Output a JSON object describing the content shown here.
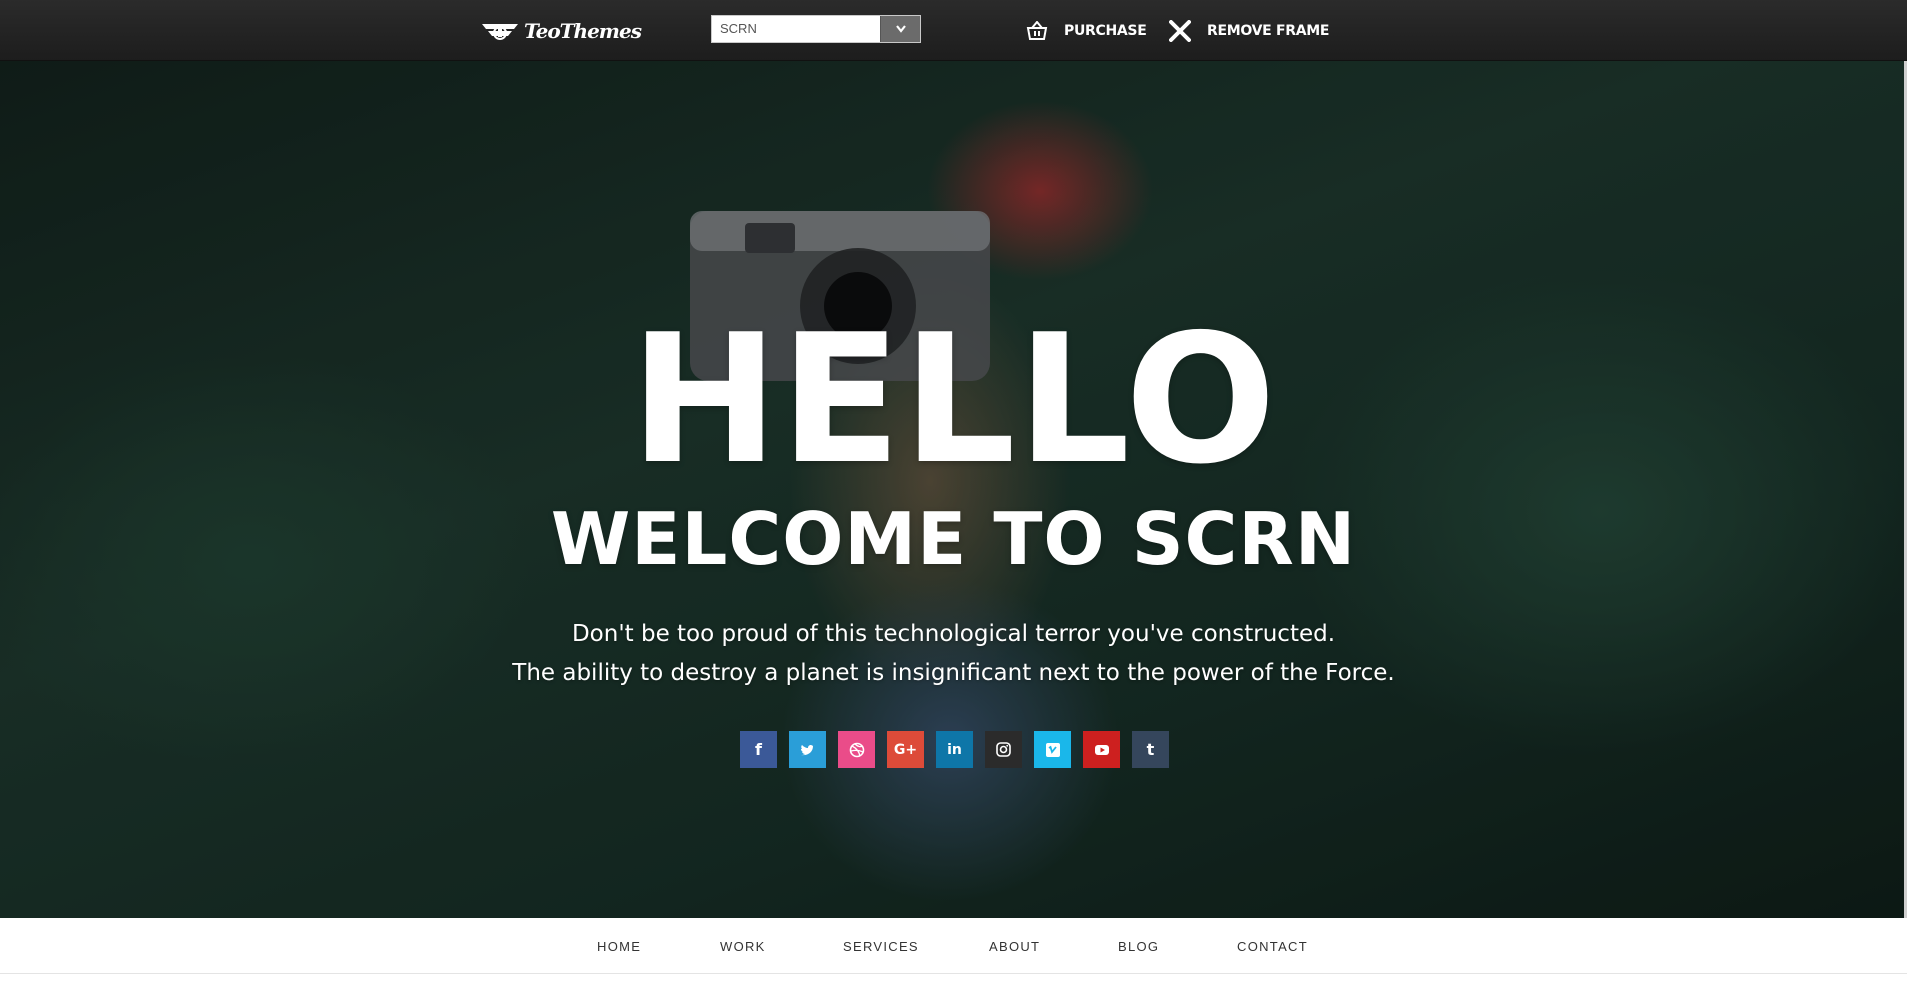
{
  "topbar": {
    "logo_text": "TeoThemes",
    "theme_select": {
      "value": "SCRN"
    },
    "purchase_label": "PURCHASE",
    "remove_frame_label": "REMOVE FRAME"
  },
  "hero": {
    "headline": "HELLO",
    "subheadline": "WELCOME TO SCRN",
    "tagline_line1": "Don't be too proud of this technological terror you've constructed.",
    "tagline_line2": "The ability to destroy a planet is insignificant next to the power of the Force.",
    "socials": [
      {
        "icon": "facebook-icon",
        "glyph": "f",
        "color": "#3b5998"
      },
      {
        "icon": "twitter-icon",
        "glyph": "t",
        "color": "#2a9ed8"
      },
      {
        "icon": "dribbble-icon",
        "glyph": "◎",
        "color": "#ea4c89"
      },
      {
        "icon": "google-plus-icon",
        "glyph": "G+",
        "color": "#dd4b39"
      },
      {
        "icon": "linkedin-icon",
        "glyph": "in",
        "color": "#0e76a8"
      },
      {
        "icon": "instagram-icon",
        "glyph": "◻",
        "color": "#2b2b2b"
      },
      {
        "icon": "vimeo-icon",
        "glyph": "v",
        "color": "#1ab7ea"
      },
      {
        "icon": "youtube-icon",
        "glyph": "▶",
        "color": "#cd201f"
      },
      {
        "icon": "tumblr-icon",
        "glyph": "t",
        "color": "#35465c"
      }
    ]
  },
  "nav": {
    "items": [
      "HOME",
      "WORK",
      "SERVICES",
      "ABOUT",
      "BLOG",
      "CONTACT"
    ]
  }
}
